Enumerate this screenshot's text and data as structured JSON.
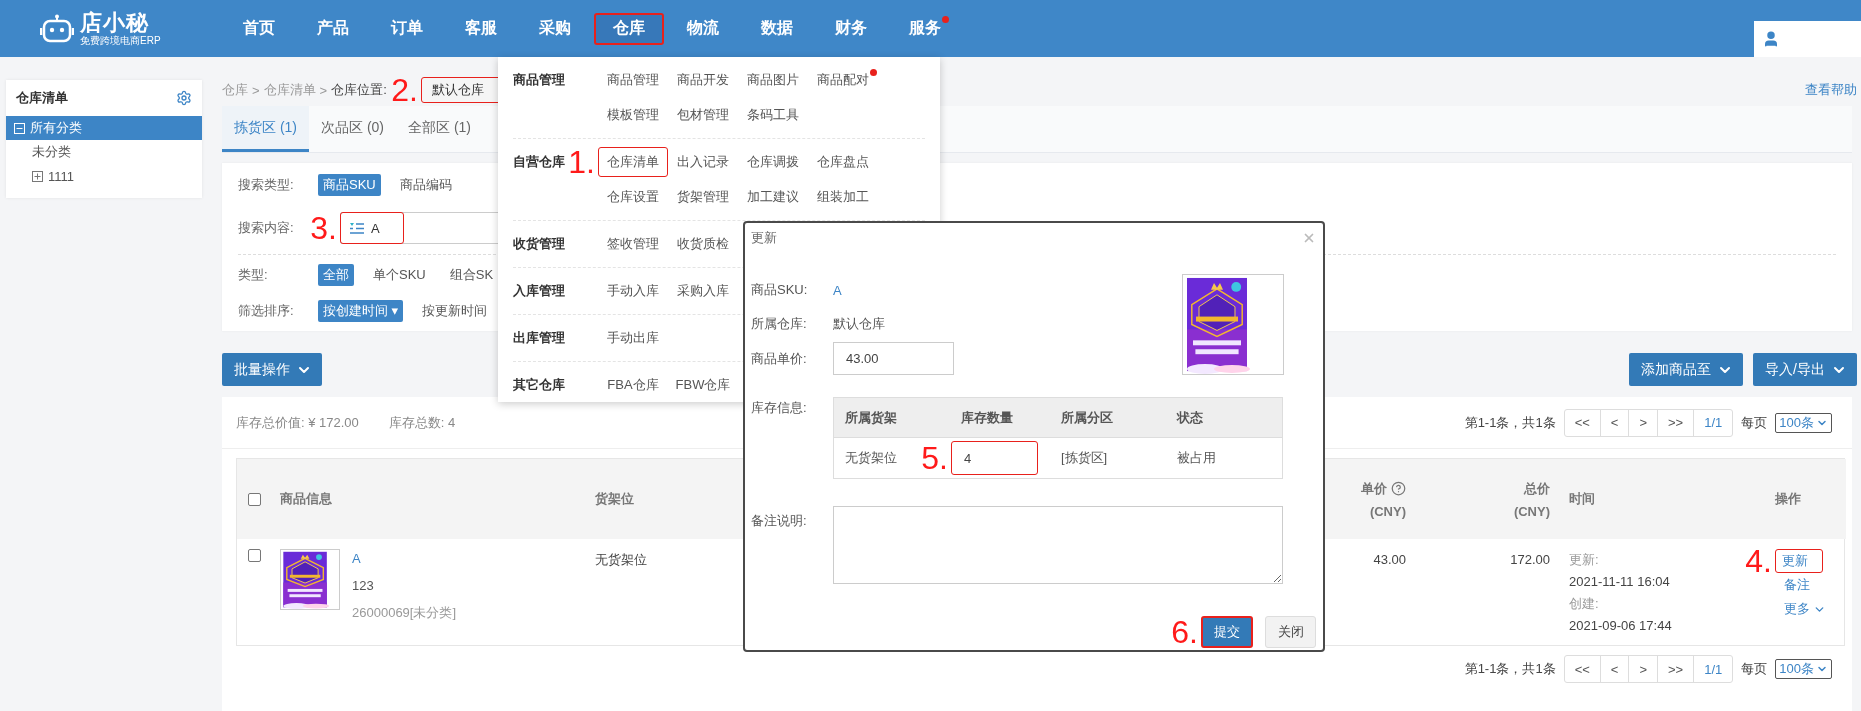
{
  "header": {
    "logo": "店小秘",
    "tagline": "免费跨境电商ERP",
    "nav": [
      {
        "label": "首页",
        "selected": false,
        "boxed": false,
        "dot": false
      },
      {
        "label": "产品",
        "selected": false,
        "boxed": false,
        "dot": false
      },
      {
        "label": "订单",
        "selected": false,
        "boxed": false,
        "dot": false
      },
      {
        "label": "客服",
        "selected": false,
        "boxed": false,
        "dot": false
      },
      {
        "label": "采购",
        "selected": false,
        "boxed": false,
        "dot": false
      },
      {
        "label": "仓库",
        "selected": true,
        "boxed": true,
        "dot": false
      },
      {
        "label": "物流",
        "selected": false,
        "boxed": false,
        "dot": false
      },
      {
        "label": "数据",
        "selected": false,
        "boxed": false,
        "dot": false
      },
      {
        "label": "财务",
        "selected": false,
        "boxed": false,
        "dot": false
      },
      {
        "label": "服务",
        "selected": false,
        "boxed": false,
        "dot": true
      }
    ]
  },
  "sidebar": {
    "title": "仓库清单",
    "tree": [
      {
        "label": "所有分类",
        "selected": true,
        "expanded": true,
        "children": [
          {
            "label": "未分类",
            "selected": false
          },
          {
            "label": "1111",
            "selected": false,
            "expanded": false
          }
        ]
      }
    ]
  },
  "breadcrumb": {
    "items": [
      {
        "label": "仓库",
        "separator": ">"
      },
      {
        "label": "仓库清单",
        "separator": ">"
      }
    ],
    "location_label": "仓库位置:",
    "location": {
      "value": "默认仓库",
      "boxed": true,
      "step": "2."
    },
    "help": "查看帮助"
  },
  "tabs": [
    {
      "label": "拣货区 (1)",
      "selected": true
    },
    {
      "label": "次品区 (0)",
      "selected": false
    },
    {
      "label": "全部区 (1)",
      "selected": false
    }
  ],
  "filters": [
    {
      "kind": "options",
      "label": "搜索类型:",
      "options": [
        {
          "label": "商品SKU",
          "selected": true
        },
        {
          "label": "商品编码",
          "selected": false
        }
      ]
    },
    {
      "kind": "input",
      "label": "搜索内容:",
      "value": "A",
      "boxed": true,
      "step": "3."
    },
    {
      "kind": "options",
      "label": "类型:",
      "options": [
        {
          "label": "全部",
          "selected": true
        },
        {
          "label": "单个SKU",
          "selected": false
        },
        {
          "label": "组合SK",
          "selected": false
        }
      ]
    },
    {
      "kind": "options",
      "label": "筛选排序:",
      "options": [
        {
          "label": "按创建时间 ▾",
          "selected": true
        },
        {
          "label": "按更新时间",
          "selected": false
        }
      ]
    }
  ],
  "toolbar": {
    "bulk": "批量操作",
    "add_to": "添加商品至",
    "import_export": "导入/导出"
  },
  "summary": {
    "total_value": "库存总价值: ¥ 172.00",
    "total_count": "库存总数: 4"
  },
  "pagination_top": {
    "range": "第1-1条，共1条",
    "buttons": [
      "<<",
      "<",
      ">",
      ">>"
    ],
    "page": "1/1",
    "per_page_label": "每页",
    "per_page": "100条"
  },
  "table": {
    "all_checked": false,
    "columns": [
      {
        "label": "商品信息"
      },
      {
        "label": "货架位"
      },
      {
        "label": "单价",
        "sub": "(CNY)",
        "help": true
      },
      {
        "label": "总价",
        "sub": "(CNY)",
        "help": false
      },
      {
        "label": "时间"
      },
      {
        "label": "操作"
      }
    ],
    "rows": [
      {
        "checked": false,
        "image": {
          "kind": "picture"
        },
        "sku": "A",
        "name": "123",
        "code": "26000069[未分类]",
        "shelf": "无货架位",
        "unit_price": "43.00",
        "total": "172.00",
        "times": [
          {
            "label": "更新:",
            "value": "2021-11-11 16:04"
          },
          {
            "label": "创建:",
            "value": "2021-09-06 17:44"
          }
        ],
        "actions": [
          {
            "label": "更新",
            "boxed": true,
            "step": "4.",
            "caret": false
          },
          {
            "label": "备注",
            "boxed": false,
            "caret": false
          },
          {
            "label": "更多",
            "boxed": false,
            "caret": true
          }
        ]
      }
    ]
  },
  "pagination_bottom": {
    "range": "第1-1条，共1条",
    "buttons": [
      "<<",
      "<",
      ">",
      ">>"
    ],
    "page": "1/1",
    "per_page_label": "每页",
    "per_page": "100条"
  },
  "menu": {
    "groups": [
      {
        "title": "商品管理",
        "rows": [
          [
            {
              "label": "商品管理",
              "boxed": false,
              "dot": false
            },
            {
              "label": "商品开发",
              "boxed": false,
              "dot": false
            },
            {
              "label": "商品图片",
              "boxed": false,
              "dot": false
            },
            {
              "label": "商品配对",
              "boxed": false,
              "dot": true
            }
          ],
          [
            {
              "label": "模板管理",
              "boxed": false,
              "dot": false
            },
            {
              "label": "包材管理",
              "boxed": false,
              "dot": false
            },
            {
              "label": "条码工具",
              "boxed": false,
              "dot": false
            }
          ]
        ]
      },
      {
        "title": "自营仓库",
        "step": "1.",
        "rows": [
          [
            {
              "label": "仓库清单",
              "boxed": true,
              "dot": false
            },
            {
              "label": "出入记录",
              "boxed": false,
              "dot": false
            },
            {
              "label": "仓库调拨",
              "boxed": false,
              "dot": false
            },
            {
              "label": "仓库盘点",
              "boxed": false,
              "dot": false
            }
          ],
          [
            {
              "label": "仓库设置",
              "boxed": false,
              "dot": false
            },
            {
              "label": "货架管理",
              "boxed": false,
              "dot": false
            },
            {
              "label": "加工建议",
              "boxed": false,
              "dot": false
            },
            {
              "label": "组装加工",
              "boxed": false,
              "dot": false
            }
          ]
        ]
      },
      {
        "title": "收货管理",
        "rows": [
          [
            {
              "label": "签收管理",
              "boxed": false,
              "dot": false
            },
            {
              "label": "收货质检",
              "boxed": false,
              "dot": false
            }
          ]
        ]
      },
      {
        "title": "入库管理",
        "rows": [
          [
            {
              "label": "手动入库",
              "boxed": false,
              "dot": false
            },
            {
              "label": "采购入库",
              "boxed": false,
              "dot": false
            }
          ]
        ]
      },
      {
        "title": "出库管理",
        "rows": [
          [
            {
              "label": "手动出库",
              "boxed": false,
              "dot": false
            }
          ]
        ]
      },
      {
        "title": "其它仓库",
        "rows": [
          [
            {
              "label": "FBA仓库",
              "boxed": false,
              "dot": false
            },
            {
              "label": "FBW仓库",
              "boxed": false,
              "dot": false
            }
          ]
        ]
      }
    ]
  },
  "modal": {
    "title": "更新",
    "sku_label": "商品SKU:",
    "sku": "A",
    "warehouse_label": "所属仓库:",
    "warehouse": "默认仓库",
    "price_label": "商品单价:",
    "price": "43.00",
    "image": {
      "kind": "picture"
    },
    "stock_label": "库存信息:",
    "stock_columns": [
      "所属货架",
      "库存数量",
      "所属分区",
      "状态"
    ],
    "stock_rows": [
      {
        "shelf": "无货架位",
        "quantity": "4",
        "boxed": true,
        "step": "5.",
        "zone": "[拣货区]",
        "status": "被占用"
      }
    ],
    "note_label": "备注说明:",
    "submit": {
      "label": "提交",
      "boxed": true,
      "step": "6."
    },
    "close": "关闭"
  }
}
